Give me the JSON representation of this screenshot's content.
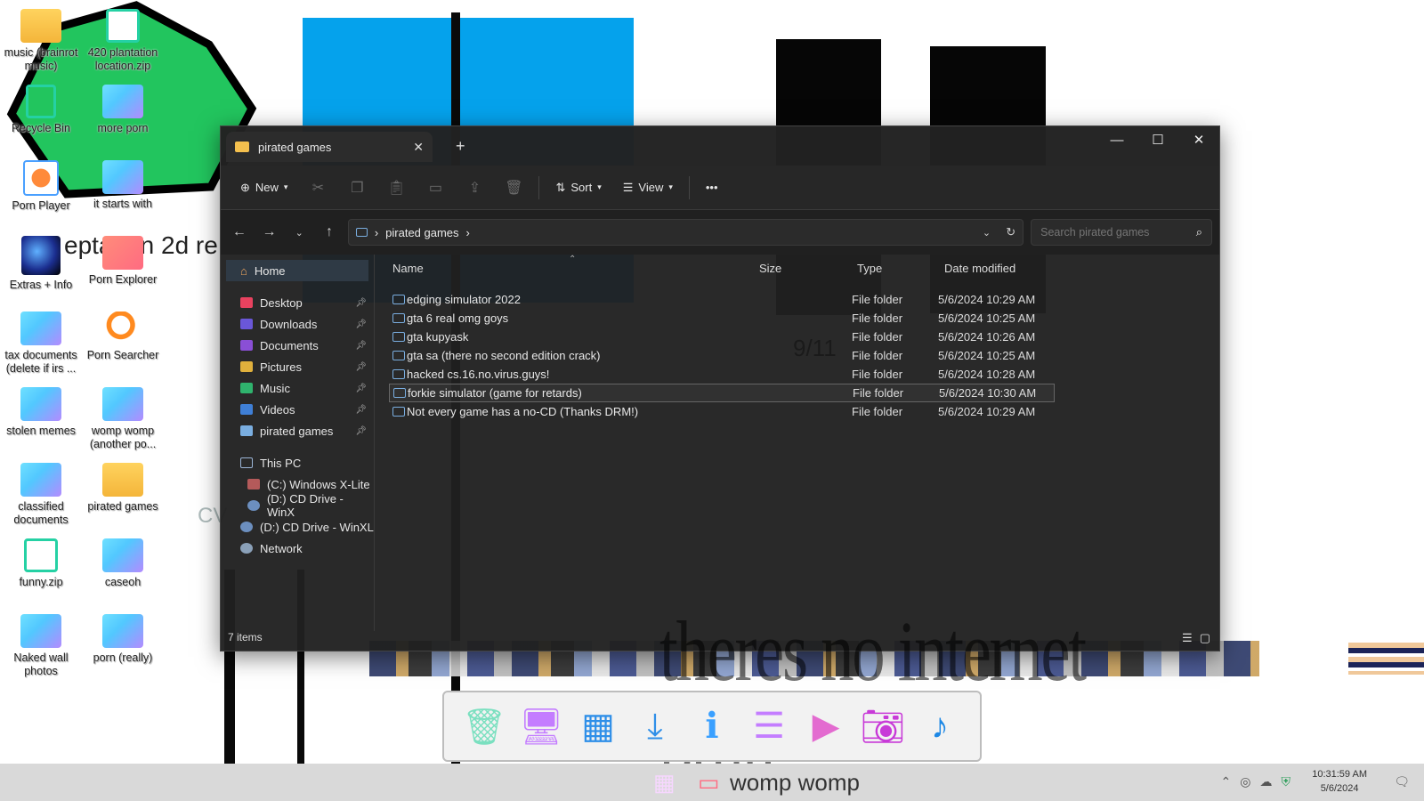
{
  "desktop": {
    "icons": [
      {
        "label": "music (brainrot music)",
        "kind": "folder-yellow"
      },
      {
        "label": "420 plantation location.zip",
        "kind": "zip"
      },
      {
        "label": "Recycle Bin",
        "kind": "bin"
      },
      {
        "label": "more porn",
        "kind": "folder"
      },
      {
        "label": "Porn Player",
        "kind": "player"
      },
      {
        "label": "it starts with",
        "kind": "folder"
      },
      {
        "label": "Extras + Info",
        "kind": "globe"
      },
      {
        "label": "Porn Explorer",
        "kind": "explorer"
      },
      {
        "label": "tax documents (delete if irs ...",
        "kind": "folder"
      },
      {
        "label": "Porn Searcher",
        "kind": "searcher"
      },
      {
        "label": "stolen memes",
        "kind": "folder"
      },
      {
        "label": "womp womp (another po...",
        "kind": "folder"
      },
      {
        "label": "classified documents",
        "kind": "folder"
      },
      {
        "label": "pirated games",
        "kind": "folder-yellow"
      },
      {
        "label": "funny.zip",
        "kind": "zip"
      },
      {
        "label": "caseoh",
        "kind": "folder"
      },
      {
        "label": "Naked wall photos",
        "kind": "folder"
      },
      {
        "label": "porn (really)",
        "kind": "folder"
      }
    ],
    "background_text": "eptagon 2d re",
    "background_text2": "CV"
  },
  "window": {
    "tab_title": "pirated games",
    "toolbar": {
      "new": "New",
      "sort": "Sort",
      "view": "View",
      "more": "•••"
    },
    "address": {
      "crumbs": [
        "pirated games"
      ]
    },
    "search": {
      "placeholder": "Search pirated games"
    },
    "sidebar": {
      "home": "Home",
      "quick": [
        {
          "label": "Desktop",
          "color": "#e8425f"
        },
        {
          "label": "Downloads",
          "color": "#6a57d8"
        },
        {
          "label": "Documents",
          "color": "#8a4fd6"
        },
        {
          "label": "Pictures",
          "color": "#e0b03c"
        },
        {
          "label": "Music",
          "color": "#2fb36d"
        },
        {
          "label": "Videos",
          "color": "#3f7fd6"
        },
        {
          "label": "pirated games",
          "color": "#7aaee0"
        }
      ],
      "thispc": "This PC",
      "drives": [
        "(C:) Windows X-Lite",
        "(D:) CD Drive - WinX"
      ],
      "drive2": "(D:) CD Drive - WinXL",
      "network": "Network"
    },
    "columns": {
      "name": "Name",
      "size": "Size",
      "type": "Type",
      "date": "Date modified"
    },
    "rows": [
      {
        "name": "edging simulator 2022",
        "type": "File folder",
        "date": "5/6/2024 10:29 AM"
      },
      {
        "name": "gta 6 real omg goys",
        "type": "File folder",
        "date": "5/6/2024 10:25 AM"
      },
      {
        "name": "gta kupyask",
        "type": "File folder",
        "date": "5/6/2024 10:26 AM"
      },
      {
        "name": "gta sa (there no second edition crack)",
        "type": "File folder",
        "date": "5/6/2024 10:25 AM"
      },
      {
        "name": "hacked cs.16.no.virus.guys!",
        "type": "File folder",
        "date": "5/6/2024 10:28 AM"
      },
      {
        "name": "forkie simulator (game for retards)",
        "type": "File folder",
        "date": "5/6/2024 10:30 AM"
      },
      {
        "name": "Not every game has a no-CD (Thanks DRM!)",
        "type": "File folder",
        "date": "5/6/2024 10:29 AM"
      }
    ],
    "overlay_text": "theres no internet bruh",
    "overlay_ghost": "9/11",
    "status": "7 items"
  },
  "taskbar": {
    "app_label": "womp womp",
    "time": "10:31:59 AM",
    "date": "5/6/2024"
  },
  "colors": {
    "window_bg": "#202020",
    "accent_blue": "#05a2ec",
    "hex_green": "#22c55e"
  }
}
